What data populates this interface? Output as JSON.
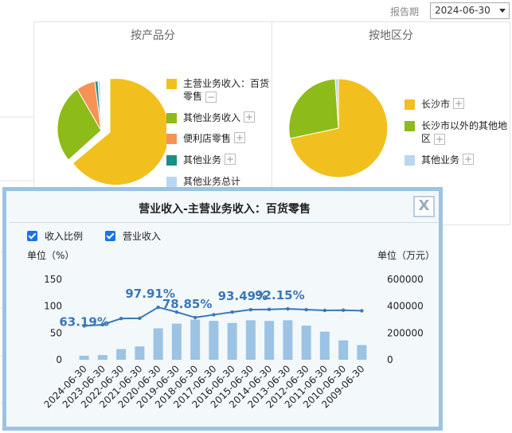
{
  "toolbar": {
    "period_label": "报告期",
    "period_value": "2024-06-30"
  },
  "panels": {
    "product": {
      "title": "按产品分",
      "legend": [
        {
          "label": "主营业务收入：百货零售",
          "color": "#f2c01e",
          "toggle": "−"
        },
        {
          "label": "其他业务收入",
          "color": "#8dbb1a",
          "toggle": "+"
        },
        {
          "label": "便利店零售",
          "color": "#f79256",
          "toggle": "+"
        },
        {
          "label": "其他业务",
          "color": "#1a8f86",
          "toggle": "+"
        },
        {
          "label": "其他业务总计",
          "color": "#b9d7f0",
          "toggle": ""
        }
      ]
    },
    "region": {
      "title": "按地区分",
      "legend": [
        {
          "label": "长沙市",
          "color": "#f2c01e",
          "toggle": "+"
        },
        {
          "label": "长沙市以外的其他地区",
          "color": "#8dbb1a",
          "toggle": "+"
        },
        {
          "label": "其他业务",
          "color": "#b9d7f0",
          "toggle": "+"
        }
      ]
    }
  },
  "popup": {
    "title": "营业收入-主营业务收入：百货零售",
    "close_label": "X",
    "checks": [
      "收入比例",
      "营业收入"
    ],
    "unit_left": "单位（%）",
    "unit_right": "单位（万元）"
  },
  "chart_data": {
    "type": "bar",
    "categories": [
      "2024-06-30",
      "2023-06-30",
      "2022-06-30",
      "2021-06-30",
      "2020-06-30",
      "2019-06-30",
      "2018-06-30",
      "2017-06-30",
      "2016-06-30",
      "2015-06-30",
      "2014-06-30",
      "2013-06-30",
      "2012-06-30",
      "2011-06-30",
      "2010-06-30",
      "2009-06-30"
    ],
    "series": [
      {
        "name": "营业收入",
        "kind": "bar",
        "axis": "right",
        "color": "#9cc3e3",
        "values": [
          30000,
          35000,
          80000,
          100000,
          235000,
          270000,
          300000,
          290000,
          275000,
          295000,
          290000,
          295000,
          255000,
          210000,
          145000,
          110000
        ]
      },
      {
        "name": "收入比例",
        "kind": "line",
        "axis": "left",
        "color": "#3a78b5",
        "values": [
          63.19,
          65.5,
          77,
          77.5,
          97.91,
          89,
          78.85,
          84,
          89,
          93.49,
          94,
          95,
          93.5,
          92.15,
          92.5,
          91.5
        ]
      }
    ],
    "annotations": [
      "63.19%",
      "97.91%",
      "78.85%",
      "93.49%",
      "92.15%"
    ],
    "annotation_indices": [
      0,
      4,
      6,
      9,
      11
    ],
    "ylim_left": [
      0,
      150
    ],
    "yticks_left": [
      "0",
      "50",
      "100",
      "150"
    ],
    "ylim_right": [
      0,
      600000
    ],
    "yticks_right": [
      "0",
      "200000",
      "400000",
      "600000"
    ]
  }
}
